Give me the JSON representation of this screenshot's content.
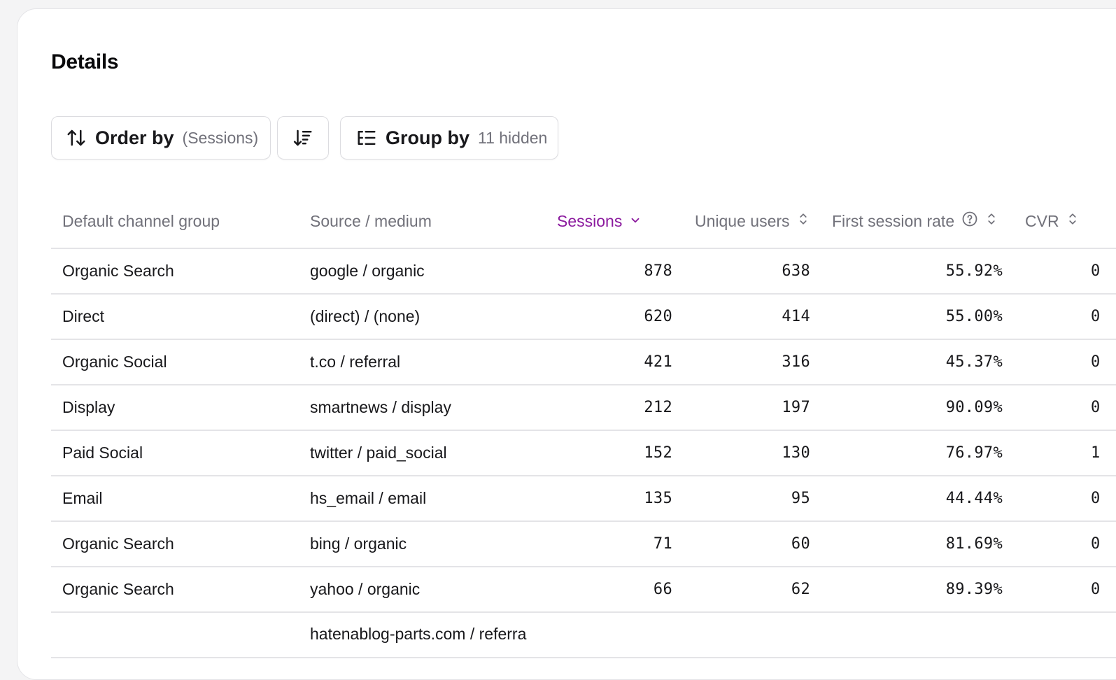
{
  "title": "Details",
  "toolbar": {
    "order_label": "Order by",
    "order_field": "(Sessions)",
    "group_label": "Group by",
    "group_hidden": "11 hidden"
  },
  "columns": {
    "channel": "Default channel group",
    "source": "Source / medium",
    "sessions": "Sessions",
    "users": "Unique users",
    "first_session": "First session rate",
    "cvr": "CVR"
  },
  "rows": [
    {
      "channel": "Organic Search",
      "source": "google / organic",
      "sessions": "878",
      "users": "638",
      "first_session": "55.92%",
      "cvr": "0"
    },
    {
      "channel": "Direct",
      "source": "(direct) / (none)",
      "sessions": "620",
      "users": "414",
      "first_session": "55.00%",
      "cvr": "0"
    },
    {
      "channel": "Organic Social",
      "source": "t.co / referral",
      "sessions": "421",
      "users": "316",
      "first_session": "45.37%",
      "cvr": "0"
    },
    {
      "channel": "Display",
      "source": "smartnews / display",
      "sessions": "212",
      "users": "197",
      "first_session": "90.09%",
      "cvr": "0"
    },
    {
      "channel": "Paid Social",
      "source": "twitter / paid_social",
      "sessions": "152",
      "users": "130",
      "first_session": "76.97%",
      "cvr": "1"
    },
    {
      "channel": "Email",
      "source": "hs_email / email",
      "sessions": "135",
      "users": "95",
      "first_session": "44.44%",
      "cvr": "0"
    },
    {
      "channel": "Organic Search",
      "source": "bing / organic",
      "sessions": "71",
      "users": "60",
      "first_session": "81.69%",
      "cvr": "0"
    },
    {
      "channel": "Organic Search",
      "source": "yahoo / organic",
      "sessions": "66",
      "users": "62",
      "first_session": "89.39%",
      "cvr": "0"
    },
    {
      "channel": "",
      "source": "hatenablog-parts.com / referra",
      "sessions": "",
      "users": "",
      "first_session": "",
      "cvr": ""
    }
  ],
  "colors": {
    "accent": "#8b1a9e",
    "muted": "#71717a",
    "border": "#e4e4e7"
  },
  "icons": {
    "order": "sort-arrows-icon",
    "direction": "sort-descending-icon",
    "group": "group-list-icon",
    "sort_active": "chevron-down-icon",
    "sort_inactive": "sort-updown-icon",
    "help": "help-circle-icon"
  }
}
